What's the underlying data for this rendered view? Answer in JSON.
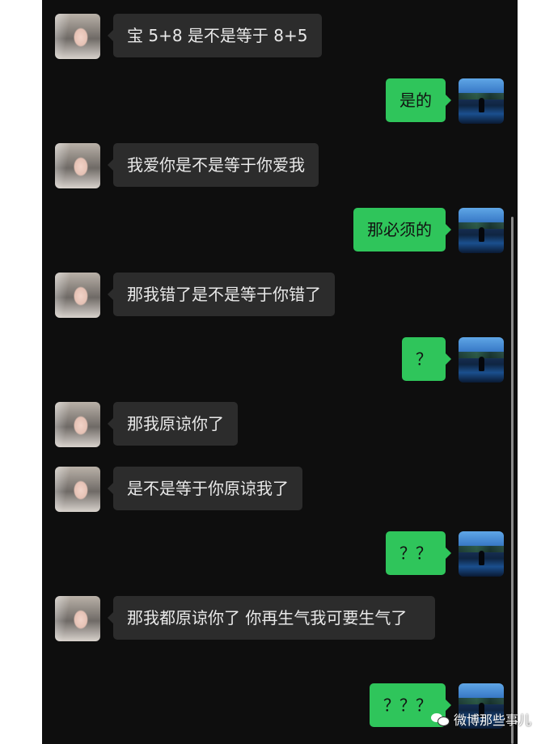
{
  "messages": [
    {
      "side": "in",
      "text": "宝 5+8 是不是等于 8+5"
    },
    {
      "side": "out",
      "text": "是的"
    },
    {
      "side": "in",
      "text": "我爱你是不是等于你爱我"
    },
    {
      "side": "out",
      "text": "那必须的"
    },
    {
      "side": "in",
      "text": "那我错了是不是等于你错了"
    },
    {
      "side": "out",
      "text": "？"
    },
    {
      "side": "in",
      "text": "那我原谅你了"
    },
    {
      "side": "in",
      "text": "是不是等于你原谅我了"
    },
    {
      "side": "out",
      "text": "？？"
    },
    {
      "side": "in",
      "text": "那我都原谅你了 你再生气我可要生气了"
    },
    {
      "side": "out",
      "text": "？？？"
    }
  ],
  "watermark": {
    "text": "微博那些事儿",
    "icon": "wechat-icon"
  },
  "colors": {
    "incoming_bubble": "#2c2c2c",
    "outgoing_bubble": "#2fc55b",
    "background": "#0e0e0e"
  }
}
